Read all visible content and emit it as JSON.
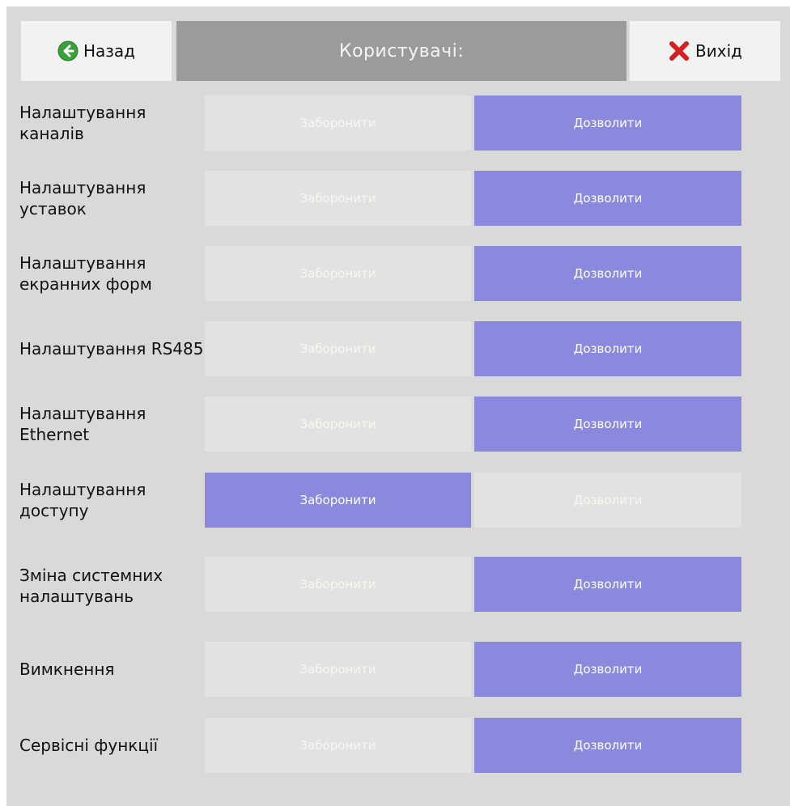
{
  "header": {
    "back_label": "Назад",
    "title": "Користувачі:",
    "exit_label": "Вихід",
    "back_icon": "back-arrow-icon",
    "exit_icon": "close-x-icon"
  },
  "options": {
    "deny": "Заборонити",
    "allow": "Дозволити"
  },
  "colors": {
    "active": "#8b89de",
    "inactive": "#e2e2e2",
    "title_bar": "#9b9b9b",
    "back_icon": "#3aa13a",
    "exit_icon": "#d42020"
  },
  "permissions": [
    {
      "label": "Налаштування каналів",
      "selected": "allow"
    },
    {
      "label": "Налаштування уставок",
      "selected": "allow"
    },
    {
      "label": "Налаштування екранних форм",
      "selected": "allow"
    },
    {
      "label": "Налаштування RS485",
      "selected": "allow"
    },
    {
      "label": "Налаштування Ethernet",
      "selected": "allow"
    },
    {
      "label": "Налаштування доступу",
      "selected": "deny"
    },
    {
      "label": "Зміна системних налаштувань",
      "selected": "allow"
    },
    {
      "label": "Вимкнення",
      "selected": "allow"
    },
    {
      "label": "Сервісні функції",
      "selected": "allow"
    }
  ]
}
